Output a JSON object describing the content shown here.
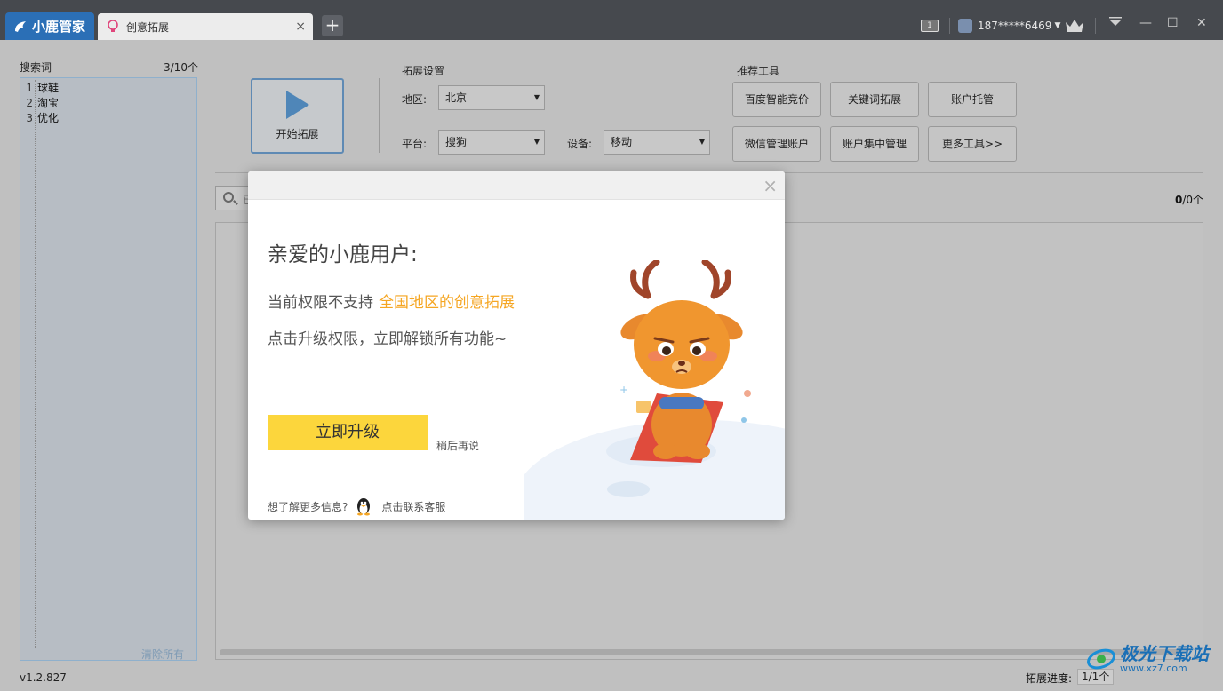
{
  "titlebar": {
    "app_name": "小鹿管家",
    "tab_label": "创意拓展",
    "tab_close": "×",
    "new_tab": "+",
    "message_count": "1",
    "user_phone": "187*****6469",
    "minimize": "—",
    "maximize": "☐",
    "close": "✕"
  },
  "keywords": {
    "label": "搜索词",
    "count": "3/10个",
    "items": [
      {
        "num": "1",
        "text": "球鞋"
      },
      {
        "num": "2",
        "text": "淘宝"
      },
      {
        "num": "3",
        "text": "优化"
      }
    ],
    "clear_all": "清除所有"
  },
  "toolbar": {
    "start_label": "开始拓展",
    "settings_title": "拓展设置",
    "region_label": "地区:",
    "region_value": "北京",
    "platform_label": "平台:",
    "platform_value": "搜狗",
    "device_label": "设备:",
    "device_value": "移动",
    "tools_title": "推荐工具",
    "tools": [
      "百度智能竞价",
      "关键词拓展",
      "账户托管",
      "微信管理账户",
      "账户集中管理",
      "更多工具>>"
    ]
  },
  "results": {
    "search_placeholder": "已",
    "count_bold": "0",
    "count_rest": "/0个"
  },
  "status": {
    "version": "v1.2.827",
    "progress_label": "拓展进度:",
    "progress_value": "1/1个"
  },
  "modal": {
    "close": "×",
    "greeting": "亲爱的小鹿用户:",
    "line1_prefix": "当前权限不支持",
    "line1_highlight": "全国地区的创意拓展",
    "line2": "点击升级权限，立即解锁所有功能~",
    "upgrade_button": "立即升级",
    "later_link": "稍后再说",
    "footer_text": "想了解更多信息?",
    "footer_link": "点击联系客服"
  },
  "watermark": {
    "title": "极光下载站",
    "url": "www.xz7.com"
  },
  "colors": {
    "titlebar": "#46494e",
    "brand_blue": "#2b6fb6",
    "highlight_orange": "#f5a623",
    "upgrade_yellow": "#fcd63c"
  }
}
